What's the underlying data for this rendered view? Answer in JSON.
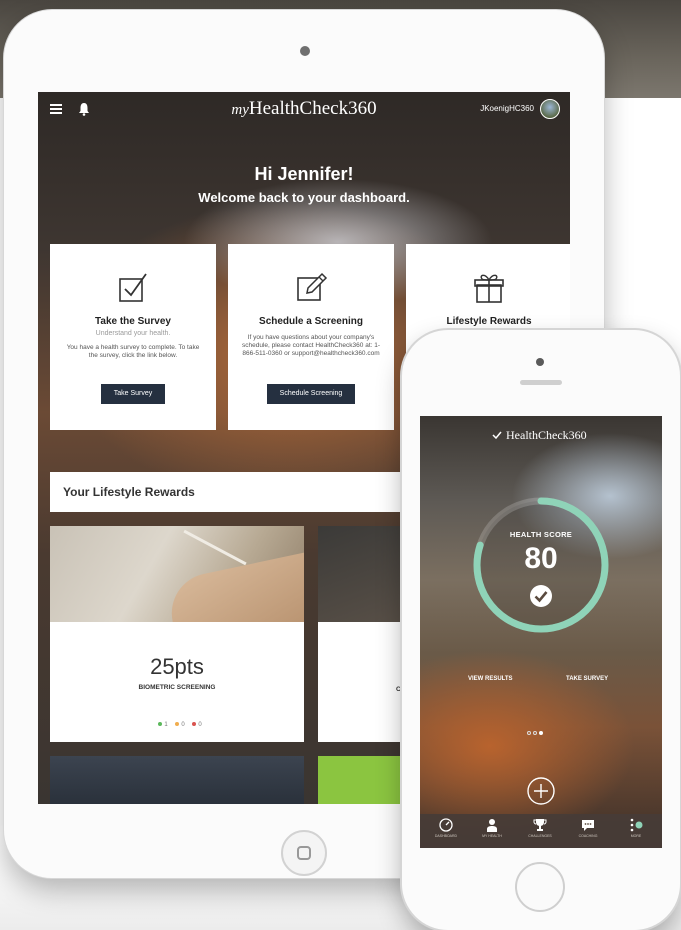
{
  "tablet": {
    "brand_prefix": "my",
    "brand_name": "HealthCheck360",
    "username": "JKoenigHC360",
    "greeting": "Hi Jennifer!",
    "welcome": "Welcome back to your dashboard.",
    "cards": [
      {
        "title": "Take the Survey",
        "subtitle": "Understand your health.",
        "description": "You have a health survey to complete. To take the survey, click the link below.",
        "button": "Take Survey",
        "icon": "checkbox-icon"
      },
      {
        "title": "Schedule a Screening",
        "description": "If you have questions about your company's schedule, please contact HealthCheck360 at: 1-866-511-0360 or support@healthcheck360.com",
        "button": "Schedule Screening",
        "icon": "edit-pencil-icon"
      },
      {
        "title": "Lifestyle Rewards",
        "icon": "gift-icon"
      }
    ],
    "rewards_heading": "Your Lifestyle Rewards",
    "reward_card": {
      "points": "25pts",
      "label": "BIOMETRIC SCREENING",
      "status_counts": [
        {
          "count": "1",
          "color": "#5cb85c"
        },
        {
          "count": "0",
          "color": "#f0ad4e"
        },
        {
          "count": "0",
          "color": "#d9534f"
        }
      ]
    },
    "second_card_partial_label": "CO"
  },
  "phone": {
    "brand_name": "HealthCheck360",
    "score_label": "HEALTH SCORE",
    "score": "80",
    "ring_color": "#8fd3b8",
    "view_results": "VIEW RESULTS",
    "take_survey": "TAKE SURVEY",
    "pager": {
      "count": 3,
      "active": 2
    },
    "tabs": [
      {
        "label": "DASHBOARD",
        "icon": "dashboard-gauge-icon"
      },
      {
        "label": "MY HEALTH",
        "icon": "person-icon"
      },
      {
        "label": "CHALLENGES",
        "icon": "trophy-icon"
      },
      {
        "label": "COACHING",
        "icon": "chat-bubble-icon"
      },
      {
        "label": "MORE",
        "icon": "more-dots-icon"
      }
    ]
  }
}
